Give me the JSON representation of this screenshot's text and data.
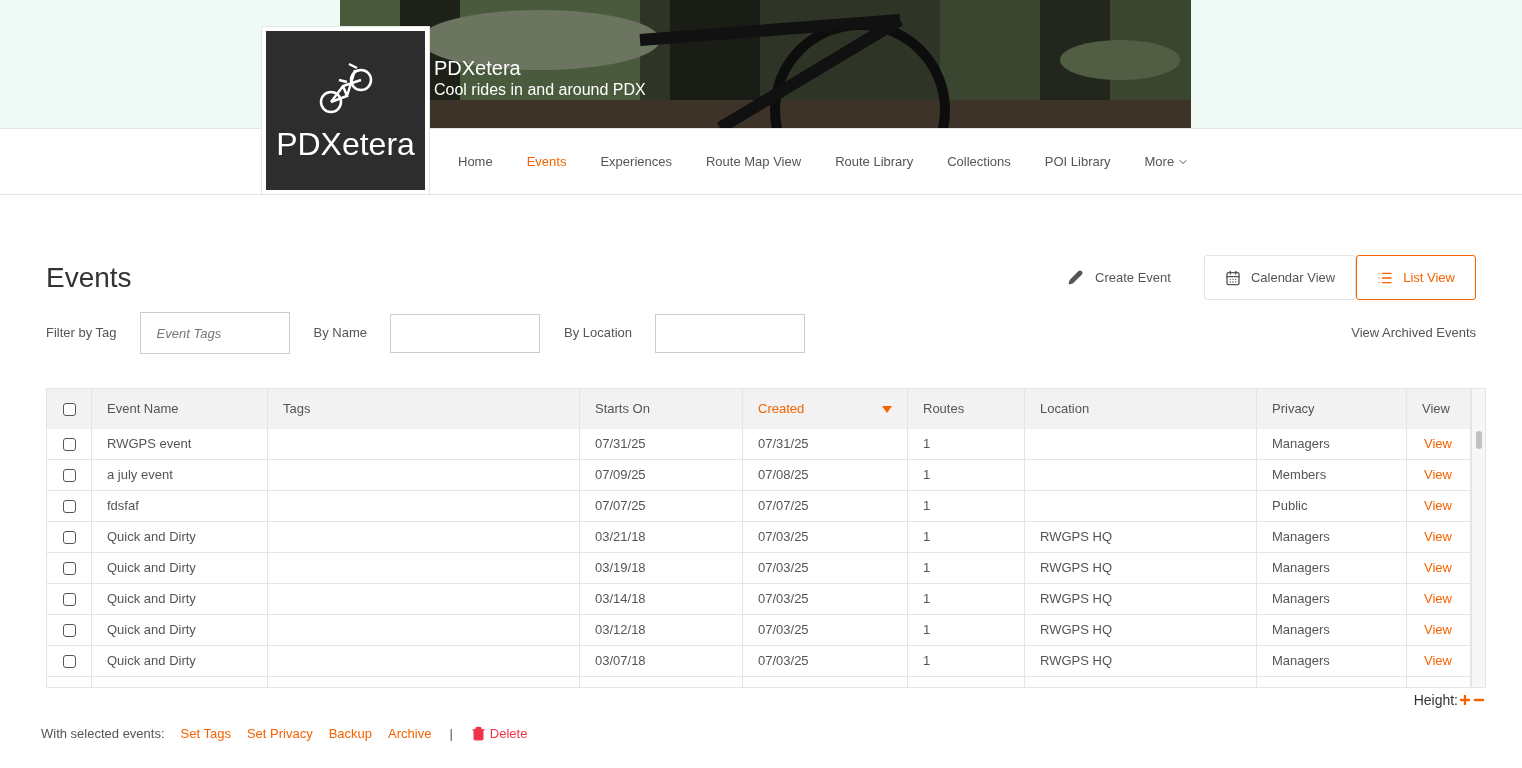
{
  "club": {
    "logo_text": "PDXetera",
    "name": "PDXetera",
    "tagline": "Cool rides in and around PDX"
  },
  "nav": [
    {
      "label": "Home",
      "selected": false,
      "kind": "link"
    },
    {
      "label": "Events",
      "selected": true,
      "kind": "link"
    },
    {
      "label": "Experiences",
      "selected": false,
      "kind": "link"
    },
    {
      "label": "Route Map View",
      "selected": false,
      "kind": "link"
    },
    {
      "label": "Route Library",
      "selected": false,
      "kind": "link"
    },
    {
      "label": "Collections",
      "selected": false,
      "kind": "link"
    },
    {
      "label": "POI Library",
      "selected": false,
      "kind": "link"
    },
    {
      "label": "More",
      "selected": false,
      "kind": "dropdown"
    }
  ],
  "page_title": "Events",
  "create_button": "Create Event",
  "views": [
    {
      "label": "Calendar View",
      "selected": false,
      "kind": "calendar"
    },
    {
      "label": "List View",
      "selected": true,
      "kind": "list"
    }
  ],
  "filters": [
    {
      "label": "Filter by Tag",
      "placeholder": "Event Tags"
    },
    {
      "label": "By Name"
    },
    {
      "label": "By Location"
    }
  ],
  "archived_link": "View Archived Events",
  "table": {
    "select_all": {
      "checked": false
    },
    "columns": [
      {
        "label": "Event Name",
        "sorted": false
      },
      {
        "label": "Tags",
        "sorted": false
      },
      {
        "label": "Starts On",
        "sorted": false
      },
      {
        "label": "Created",
        "sorted": true
      },
      {
        "label": "Routes",
        "sorted": false
      },
      {
        "label": "Location",
        "sorted": false
      },
      {
        "label": "Privacy",
        "sorted": false
      },
      {
        "label": "View",
        "sorted": false
      }
    ],
    "rows": [
      {
        "checked": false,
        "cells": [
          "RWGPS event",
          "",
          "07/31/25",
          "07/31/25",
          "1",
          "",
          "Managers"
        ],
        "link": "View"
      },
      {
        "checked": false,
        "cells": [
          "a july event",
          "",
          "07/09/25",
          "07/08/25",
          "1",
          "",
          "Members"
        ],
        "link": "View"
      },
      {
        "checked": false,
        "cells": [
          "fdsfaf",
          "",
          "07/07/25",
          "07/07/25",
          "1",
          "",
          "Public"
        ],
        "link": "View"
      },
      {
        "checked": false,
        "cells": [
          "Quick and Dirty",
          "",
          "03/21/18",
          "07/03/25",
          "1",
          "RWGPS HQ",
          "Managers"
        ],
        "link": "View"
      },
      {
        "checked": false,
        "cells": [
          "Quick and Dirty",
          "",
          "03/19/18",
          "07/03/25",
          "1",
          "RWGPS HQ",
          "Managers"
        ],
        "link": "View"
      },
      {
        "checked": false,
        "cells": [
          "Quick and Dirty",
          "",
          "03/14/18",
          "07/03/25",
          "1",
          "RWGPS HQ",
          "Managers"
        ],
        "link": "View"
      },
      {
        "checked": false,
        "cells": [
          "Quick and Dirty",
          "",
          "03/12/18",
          "07/03/25",
          "1",
          "RWGPS HQ",
          "Managers"
        ],
        "link": "View"
      },
      {
        "checked": false,
        "cells": [
          "Quick and Dirty",
          "",
          "03/07/18",
          "07/03/25",
          "1",
          "RWGPS HQ",
          "Managers"
        ],
        "link": "View"
      }
    ]
  },
  "height_label": "Height:",
  "bulk": {
    "label": "With selected events:",
    "separator": "|",
    "actions": [
      {
        "label": "Set Tags",
        "kind": "link"
      },
      {
        "label": "Set Privacy",
        "kind": "link"
      },
      {
        "label": "Backup",
        "kind": "link"
      },
      {
        "label": "Archive",
        "kind": "link"
      },
      {
        "label": "Delete",
        "kind": "danger"
      }
    ]
  }
}
